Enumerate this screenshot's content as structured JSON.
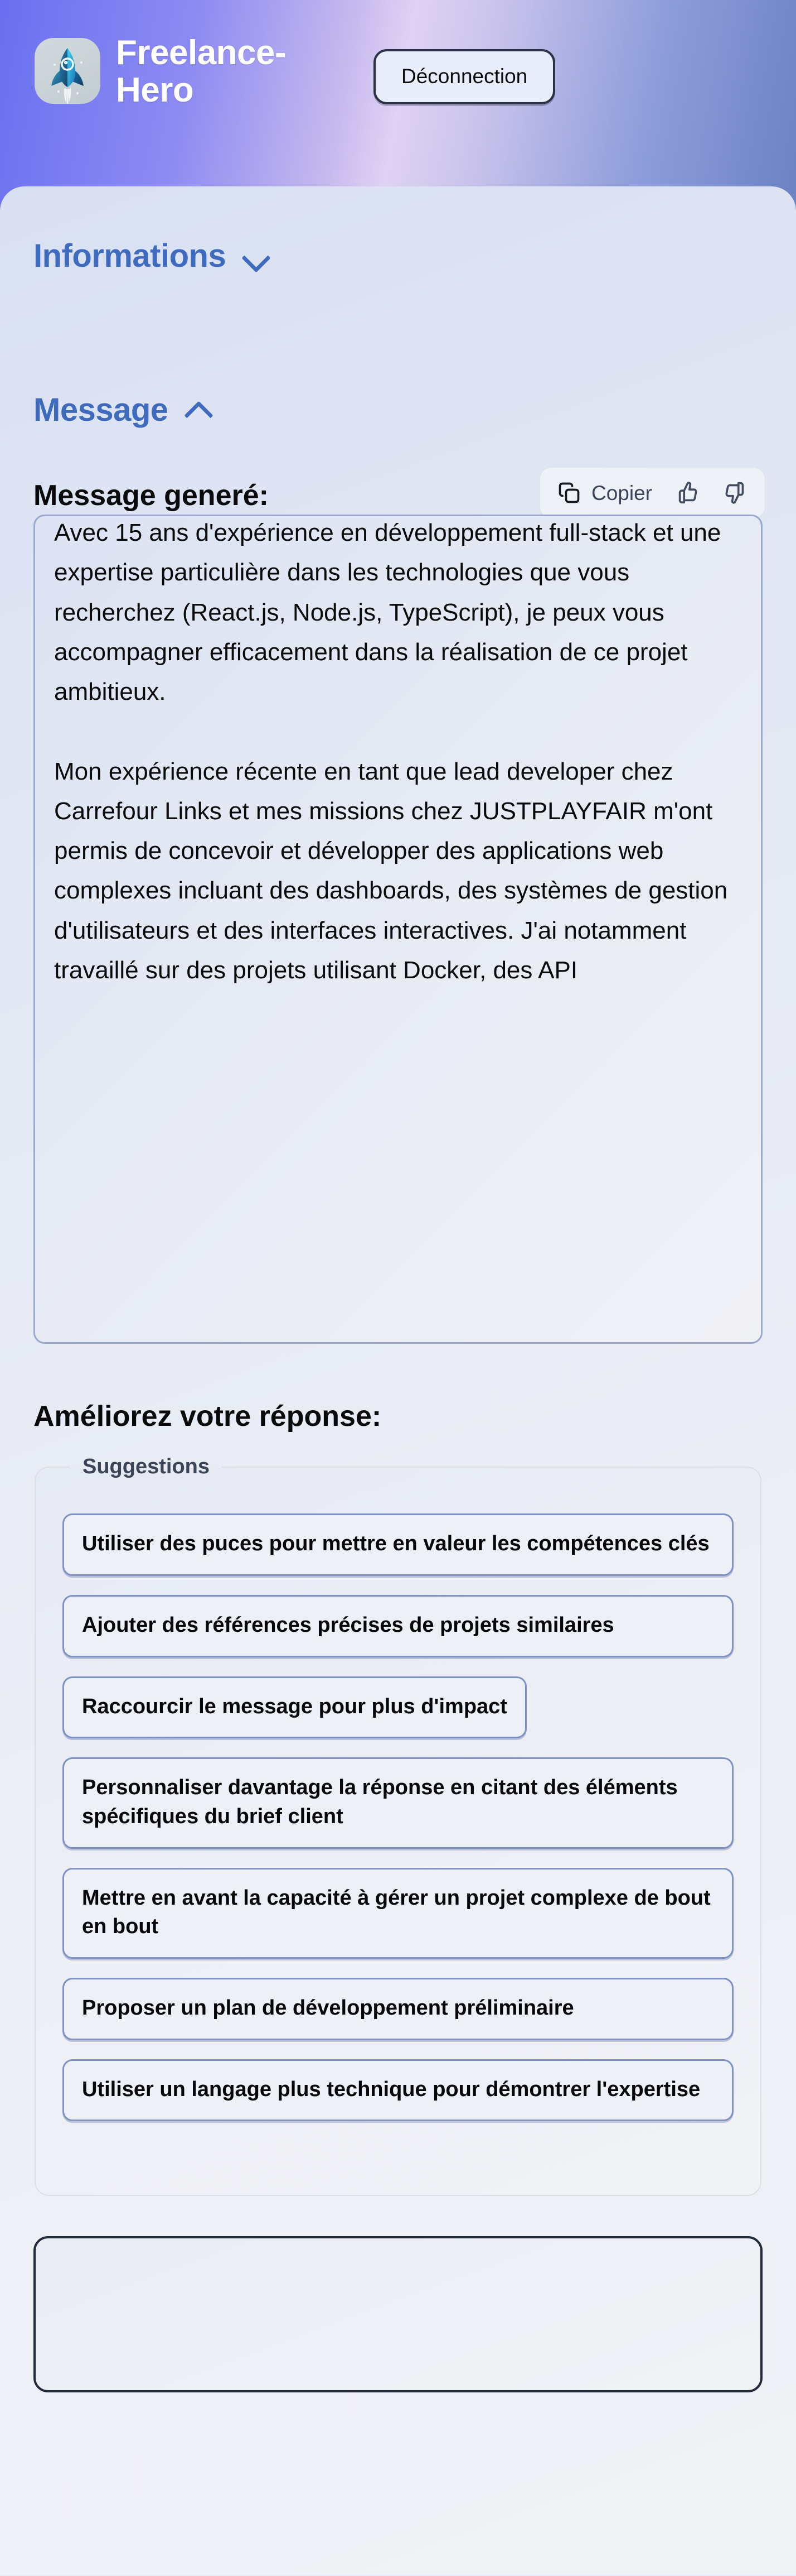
{
  "header": {
    "brand_name": "Freelance-Hero",
    "logo_icon": "rocket-icon",
    "logout_label": "Déconnection",
    "gradient_start": "#6a6ff0",
    "gradient_mid": "#dfd2f4",
    "gradient_end": "#6b82c3"
  },
  "sections": {
    "informations": {
      "title": "Informations",
      "chevron_icon": "chevron-down-icon",
      "expanded": false
    },
    "message": {
      "title": "Message",
      "chevron_icon": "chevron-up-icon",
      "expanded": true
    }
  },
  "message_panel": {
    "generated_label": "Message generé:",
    "toolbar": {
      "copy_label": "Copier",
      "copy_icon": "copy-icon",
      "thumbs_up_icon": "thumbs-up-icon",
      "thumbs_down_icon": "thumbs-down-icon"
    },
    "textarea_value": "Avec 15 ans d'expérience en développement full-stack et une expertise particulière dans les technologies que vous recherchez (React.js, Node.js, TypeScript), je peux vous accompagner efficacement dans la réalisation de ce projet ambitieux.\n\nMon expérience récente en tant que lead developer chez Carrefour Links et mes missions chez JUSTPLAYFAIR m'ont permis de concevoir et développer des applications web complexes incluant des dashboards, des systèmes de gestion d'utilisateurs et des interfaces interactives. J'ai notamment travaillé sur des projets utilisant Docker, des API",
    "accent_border": "#9aa9cf"
  },
  "improve_panel": {
    "title": "Améliorez votre réponse:",
    "fieldset_legend": "Suggestions",
    "suggestions": [
      {
        "label": "Utiliser des puces pour mettre en valeur les compétences clés",
        "width": "full"
      },
      {
        "label": "Ajouter des références précises de projets similaires",
        "width": "full"
      },
      {
        "label": "Raccourcir le message pour plus d'impact",
        "width": "fit"
      },
      {
        "label": "Personnaliser davantage la réponse en citant des éléments spécifiques du brief client",
        "width": "full"
      },
      {
        "label": "Mettre en avant la capacité à gérer un projet complexe de bout en bout",
        "width": "full"
      },
      {
        "label": "Proposer un plan de développement préliminaire",
        "width": "full"
      },
      {
        "label": "Utiliser un langage plus technique pour démontrer l'expertise",
        "width": "full"
      }
    ]
  },
  "bottom_box": {
    "content": "",
    "border_color": "#232a3c"
  }
}
